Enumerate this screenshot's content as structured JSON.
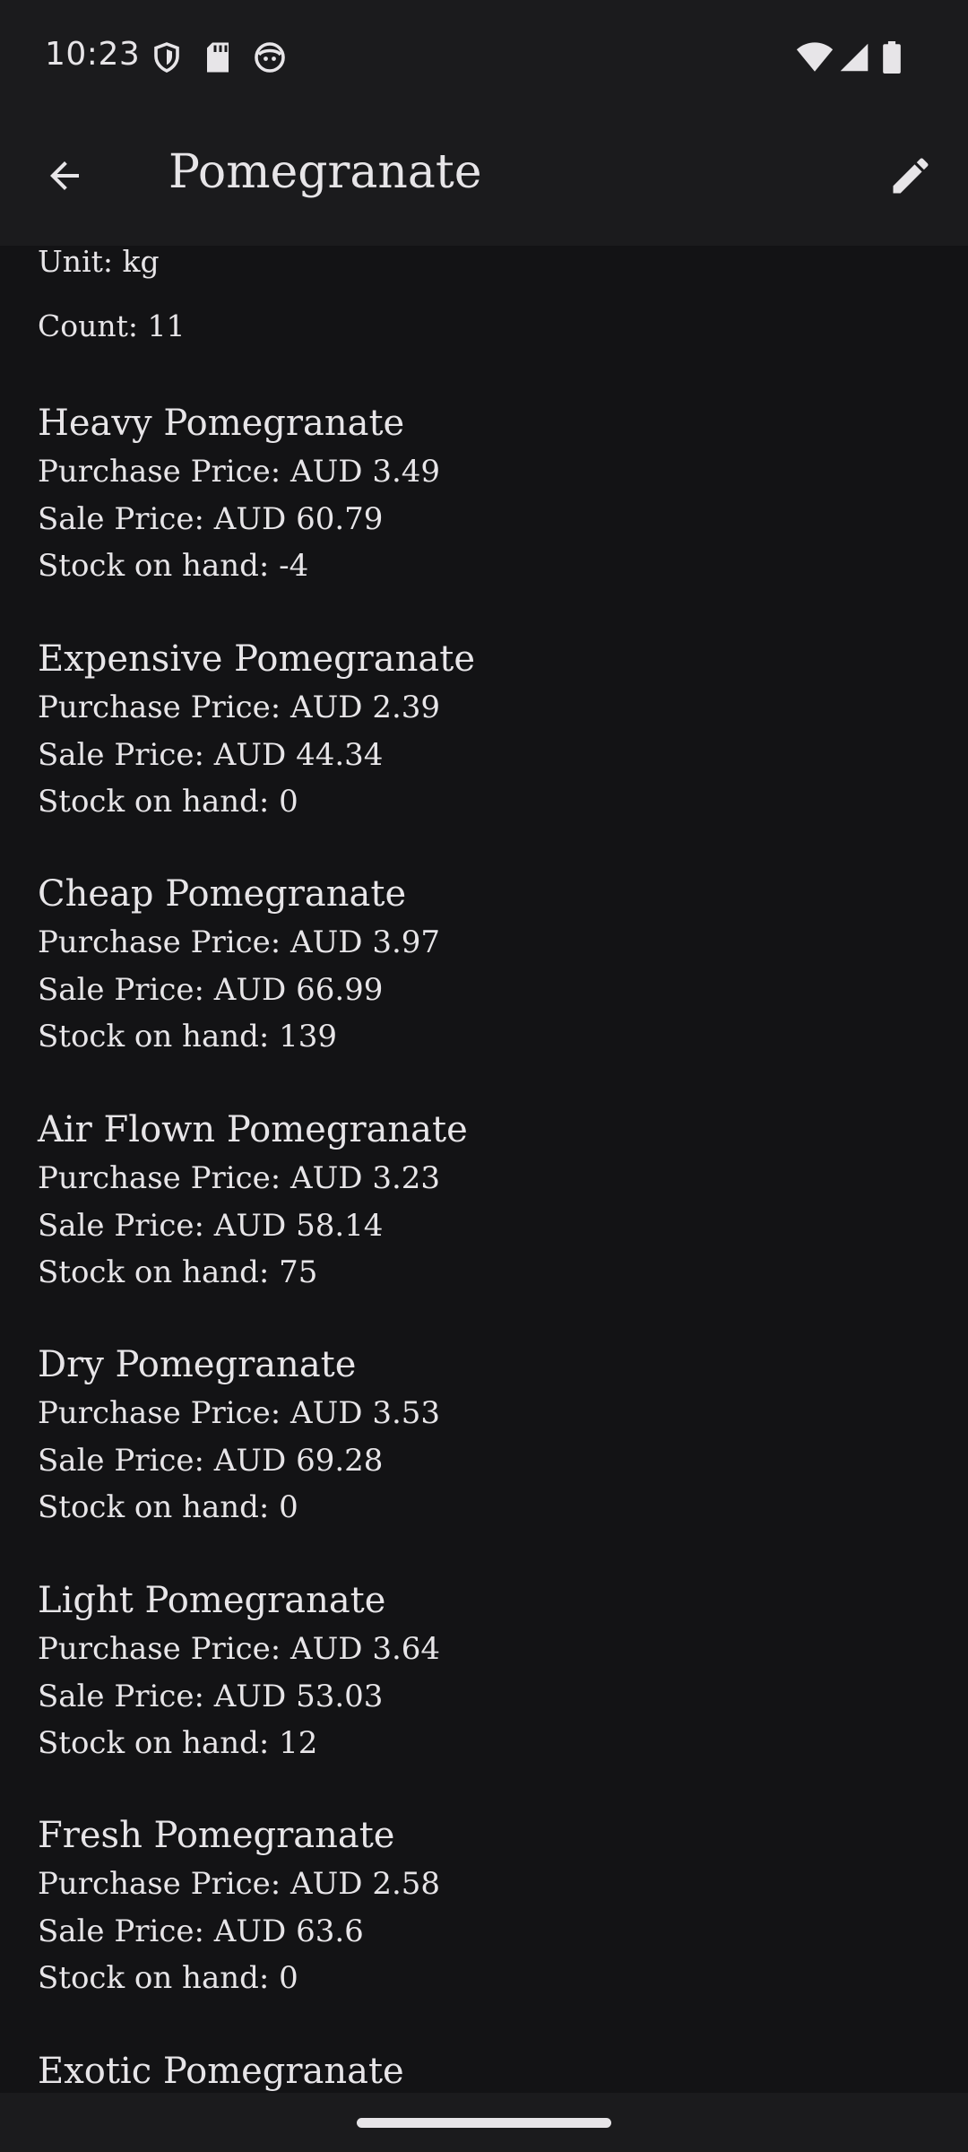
{
  "status_bar": {
    "time": "10:23",
    "left_icons": [
      "shield-icon",
      "sd-card-icon",
      "face-icon"
    ],
    "right_icons": [
      "wifi-icon",
      "cellular-signal-icon",
      "battery-icon"
    ]
  },
  "app_bar": {
    "title": "Pomegranate",
    "back_icon": "arrow-back-icon",
    "edit_icon": "pencil-icon"
  },
  "details": {
    "unit": "Unit: kg",
    "count": "Count: 11"
  },
  "products": [
    {
      "name": "Heavy Pomegranate",
      "purchase": "Purchase Price: AUD 3.49",
      "sale": "Sale Price: AUD 60.79",
      "stock": "Stock on hand: -4"
    },
    {
      "name": "Expensive Pomegranate",
      "purchase": "Purchase Price: AUD 2.39",
      "sale": "Sale Price: AUD 44.34",
      "stock": "Stock on hand: 0"
    },
    {
      "name": "Cheap Pomegranate",
      "purchase": "Purchase Price: AUD 3.97",
      "sale": "Sale Price: AUD 66.99",
      "stock": "Stock on hand: 139"
    },
    {
      "name": "Air Flown Pomegranate",
      "purchase": "Purchase Price: AUD 3.23",
      "sale": "Sale Price: AUD 58.14",
      "stock": "Stock on hand: 75"
    },
    {
      "name": "Dry Pomegranate",
      "purchase": "Purchase Price: AUD 3.53",
      "sale": "Sale Price: AUD 69.28",
      "stock": "Stock on hand: 0"
    },
    {
      "name": "Light Pomegranate",
      "purchase": "Purchase Price: AUD 3.64",
      "sale": "Sale Price: AUD 53.03",
      "stock": "Stock on hand: 12"
    },
    {
      "name": "Fresh Pomegranate",
      "purchase": "Purchase Price: AUD 2.58",
      "sale": "Sale Price: AUD 63.6",
      "stock": "Stock on hand: 0"
    },
    {
      "name": "Exotic Pomegranate"
    }
  ],
  "colors": {
    "background": "#131315",
    "bar": "#1b1b1d",
    "text": "#e7e5e8"
  }
}
